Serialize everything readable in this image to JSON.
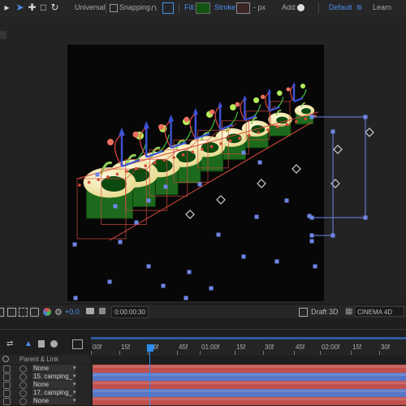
{
  "toolbar": {
    "universal_label": "Universal",
    "snapping_label": "Snapping",
    "fill_label": "Fill:",
    "stroke_label": "Stroke:",
    "px_label": "- px",
    "add_label": "Add:",
    "workspace_active": "Default",
    "workspace_other": "Learn",
    "fill_color": "#115511",
    "stroke_color": "#3a2424",
    "accent_color": "#4d8ff0",
    "icons": [
      "selection-arrow-icon",
      "hand-icon",
      "rectangle-icon",
      "rotate-icon",
      "snapping-checkbox",
      "magnet-icon",
      "add-circle-icon",
      "workspace-menu-icon"
    ]
  },
  "viewer_footer": {
    "exposure": "+0.0",
    "timecode": "0:00:00:30",
    "draft_label": "Draft 3D",
    "renderer": "CINEMA 4D",
    "icons": [
      "region-icon",
      "safe-zones-icon",
      "color-channels-icon",
      "snapshot-icon",
      "show-snapshot-icon",
      "draft-3d-icon",
      "renderer-dropdown-icon"
    ]
  },
  "timeline": {
    "column_header": "Parent & Link",
    "ruler_ticks": [
      "00f",
      "15f",
      "30f",
      "45f",
      "01:00f",
      "15f",
      "30f",
      "45f",
      "02:00f",
      "15f",
      "30f"
    ],
    "current_frame_label": "30f",
    "layers": [
      {
        "parent": "None"
      },
      {
        "parent": "15. camping_"
      },
      {
        "parent": "None"
      },
      {
        "parent": "17. camping_"
      },
      {
        "parent": "None"
      }
    ],
    "bar_colors": [
      "#c0504d",
      "#5875c6",
      "#c0504d",
      "#5875c6",
      "#c0504d"
    ],
    "playhead_color": "#2d8ceb"
  },
  "composition": {
    "background": "#070707",
    "object_color": "#1d6a1d",
    "bounding_box_color": "#d64a3a",
    "handle_color": "#6f86e8"
  }
}
